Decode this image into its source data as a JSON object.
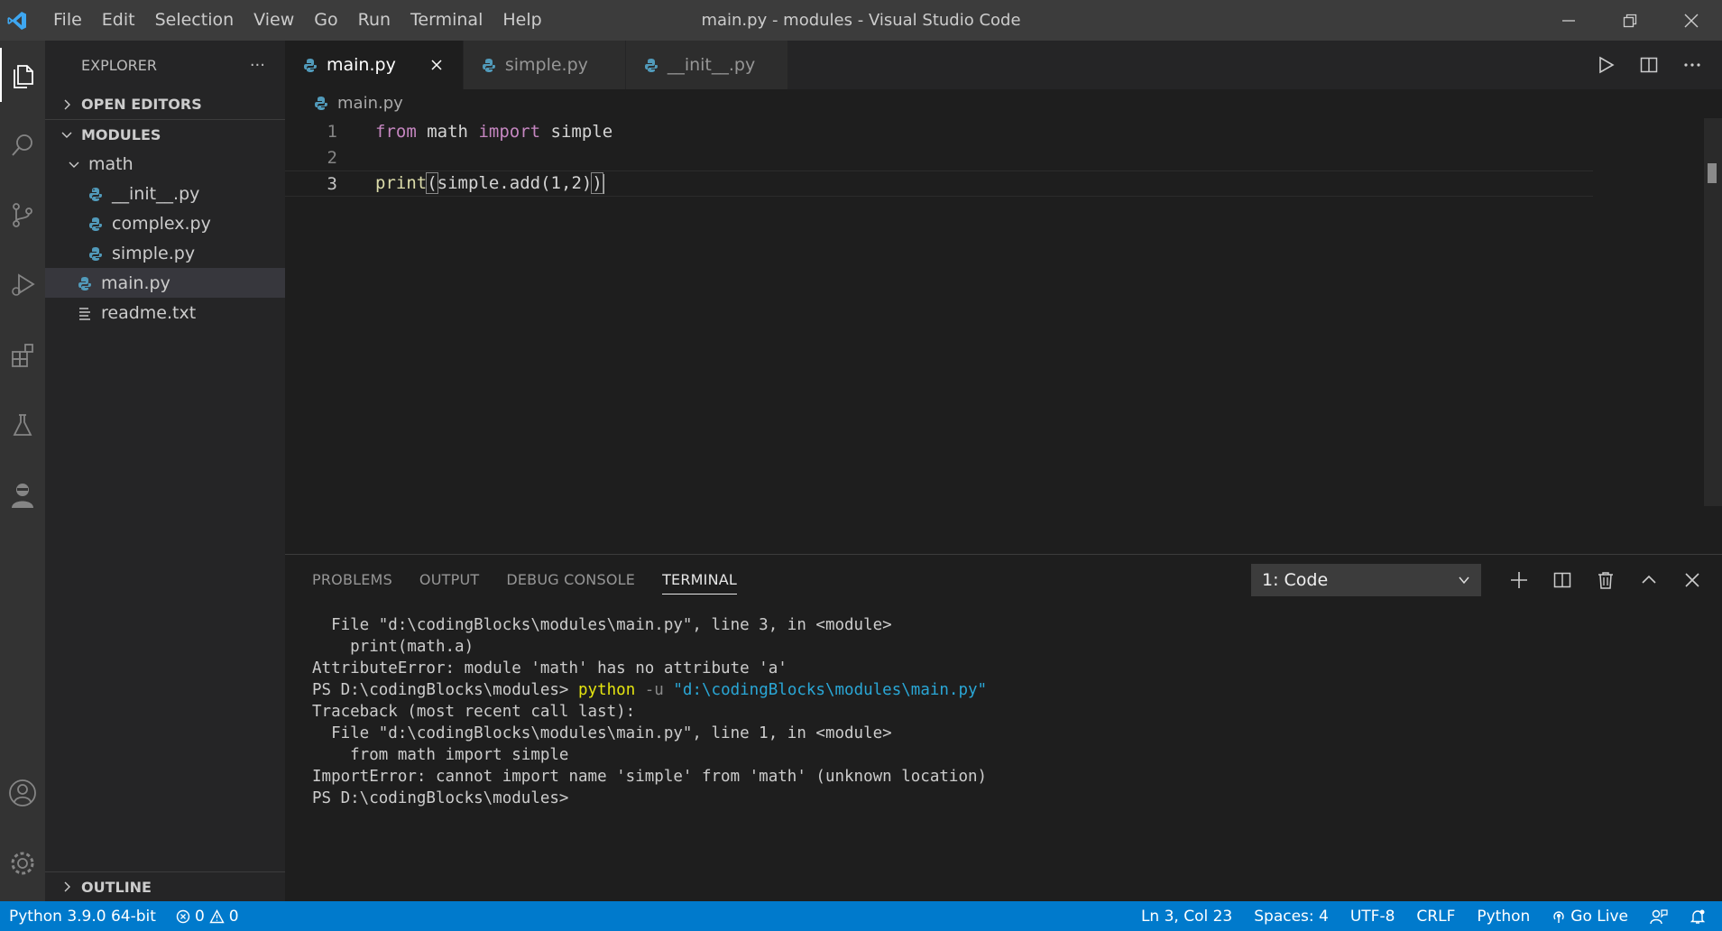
{
  "window": {
    "title": "main.py - modules - Visual Studio Code",
    "menu": [
      "File",
      "Edit",
      "Selection",
      "View",
      "Go",
      "Run",
      "Terminal",
      "Help"
    ]
  },
  "activity_bar": {
    "items": [
      "explorer",
      "search",
      "source-control",
      "run-debug",
      "extensions",
      "testing",
      "live-share"
    ],
    "bottom": [
      "accounts",
      "manage"
    ]
  },
  "sidebar": {
    "title": "EXPLORER",
    "more": "···",
    "sections": {
      "open_editors": "OPEN EDITORS",
      "modules": "MODULES",
      "outline": "OUTLINE"
    },
    "tree": {
      "folder_math": "math",
      "files": [
        "__init__.py",
        "complex.py",
        "simple.py"
      ],
      "main": "main.py",
      "readme": "readme.txt"
    }
  },
  "tabs": [
    {
      "label": "main.py"
    },
    {
      "label": "simple.py"
    },
    {
      "label": "__init__.py"
    }
  ],
  "breadcrumb": "main.py",
  "code": {
    "line_numbers": [
      "1",
      "2",
      "3"
    ],
    "line1": {
      "kw1": "from",
      "mod": "math",
      "kw2": "import",
      "name": "simple"
    },
    "line3": {
      "fn": "print",
      "open": "(",
      "obj": "simple",
      "dot": ".",
      "method": "add",
      "p1": "(",
      "a": "1",
      "comma": ",",
      "b": "2",
      "p2": ")",
      "close": ")"
    }
  },
  "panel": {
    "tabs": [
      "PROBLEMS",
      "OUTPUT",
      "DEBUG CONSOLE",
      "TERMINAL"
    ],
    "terminal_select": "1: Code",
    "terminal_lines": {
      "l1": "  File \"d:\\codingBlocks\\modules\\main.py\", line 3, in <module>",
      "l2": "    print(math.a)",
      "l3": "AttributeError: module 'math' has no attribute 'a'",
      "l4_prompt": "PS D:\\codingBlocks\\modules> ",
      "l4_cmd": "python",
      "l4_flag": " -u ",
      "l4_path": "\"d:\\codingBlocks\\modules\\main.py\"",
      "l5": "Traceback (most recent call last):",
      "l6": "  File \"d:\\codingBlocks\\modules\\main.py\", line 1, in <module>",
      "l7": "    from math import simple",
      "l8": "ImportError: cannot import name 'simple' from 'math' (unknown location)",
      "l9": "PS D:\\codingBlocks\\modules>"
    }
  },
  "statusbar": {
    "python": "Python 3.9.0 64-bit",
    "errors": "0",
    "warnings": "0",
    "position": "Ln 3, Col 23",
    "spaces": "Spaces: 4",
    "encoding": "UTF-8",
    "eol": "CRLF",
    "language": "Python",
    "golive": "Go Live"
  },
  "colors": {
    "accent": "#007acc",
    "keyword": "#c586c0",
    "function": "#dcdcaa",
    "variable": "#9cdcfe",
    "number": "#b5cea8",
    "python_icon": "#519aba"
  }
}
